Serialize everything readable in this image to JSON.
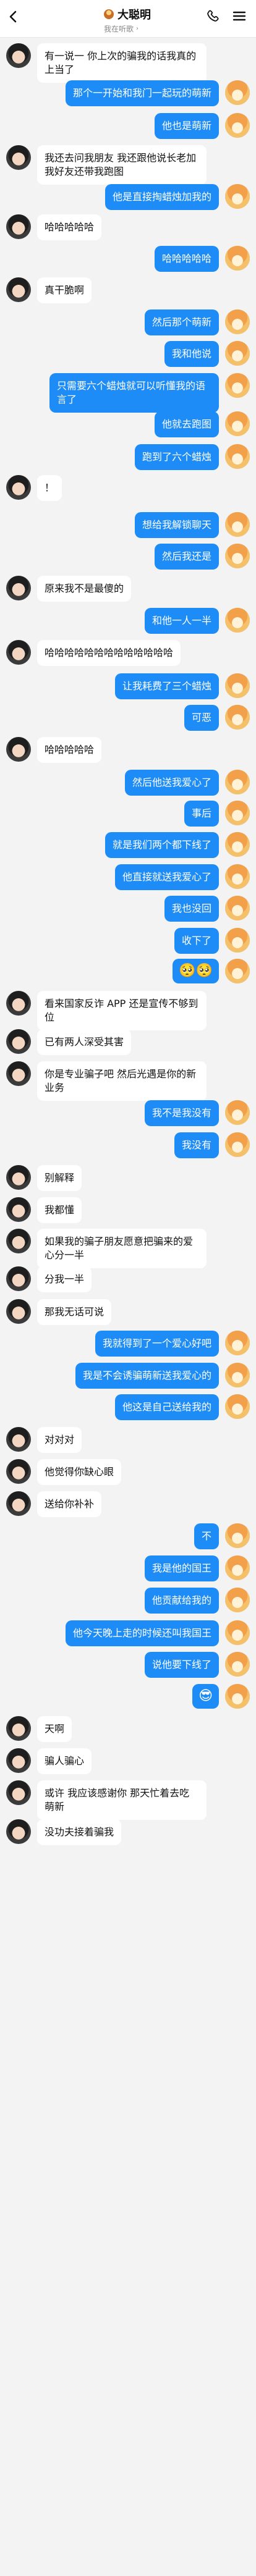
{
  "header": {
    "title": "大聪明",
    "subtitle": "我在听歌",
    "icons": {
      "back": "chevron-left",
      "phone": "phone",
      "menu": "hamburger-menu"
    }
  },
  "chat": {
    "messages": [
      {
        "type": "text",
        "side": "left",
        "text": "有一说一  你上次的骗我的话我真的  上当了"
      },
      {
        "type": "text",
        "side": "right",
        "text": "那个一开始和我门一起玩的萌新"
      },
      {
        "type": "text",
        "side": "right",
        "text": "他也是萌新"
      },
      {
        "type": "text",
        "side": "left",
        "text": "我还去问我朋友  我还跟他说长老加我好友还带我跑图"
      },
      {
        "type": "text",
        "side": "right",
        "text": "他是直接掏蜡烛加我的"
      },
      {
        "type": "text",
        "side": "left",
        "text": "哈哈哈哈哈"
      },
      {
        "type": "text",
        "side": "right",
        "text": "哈哈哈哈哈"
      },
      {
        "type": "text",
        "side": "left",
        "text": "真干脆啊"
      },
      {
        "type": "text",
        "side": "right",
        "text": "然后那个萌新"
      },
      {
        "type": "text",
        "side": "right",
        "text": "我和他说"
      },
      {
        "type": "text",
        "side": "right",
        "text": "只需要六个蜡烛就可以听懂我的语言了"
      },
      {
        "type": "text",
        "side": "right",
        "text": "他就去跑图"
      },
      {
        "type": "text",
        "side": "right",
        "text": "跑到了六个蜡烛"
      },
      {
        "type": "text",
        "side": "left",
        "text": "！"
      },
      {
        "type": "text",
        "side": "right",
        "text": "想给我解锁聊天"
      },
      {
        "type": "text",
        "side": "right",
        "text": "然后我还是"
      },
      {
        "type": "text",
        "side": "left",
        "text": "原来我不是最傻的"
      },
      {
        "type": "text",
        "side": "right",
        "text": "和他一人一半"
      },
      {
        "type": "text",
        "side": "left",
        "text": "哈哈哈哈哈哈哈哈哈哈哈哈哈"
      },
      {
        "type": "text",
        "side": "right",
        "text": "让我耗费了三个蜡烛"
      },
      {
        "type": "text",
        "side": "right",
        "text": "可恶"
      },
      {
        "type": "text",
        "side": "left",
        "text": "哈哈哈哈哈"
      },
      {
        "type": "text",
        "side": "right",
        "text": "然后他送我爱心了"
      },
      {
        "type": "text",
        "side": "right",
        "text": "事后"
      },
      {
        "type": "text",
        "side": "right",
        "text": "就是我们两个都下线了"
      },
      {
        "type": "text",
        "side": "right",
        "text": "他直接就送我爱心了"
      },
      {
        "type": "text",
        "side": "right",
        "text": "我也没回"
      },
      {
        "type": "text",
        "side": "right",
        "text": "收下了"
      },
      {
        "type": "emoji",
        "side": "right",
        "text": "🥺🥺"
      },
      {
        "type": "text",
        "side": "left",
        "text": "看来国家反诈 APP 还是宣传不够到位"
      },
      {
        "type": "text",
        "side": "left",
        "text": "已有两人深受其害"
      },
      {
        "type": "text",
        "side": "left",
        "text": "你是专业骗子吧  然后光遇是你的新业务"
      },
      {
        "type": "text",
        "side": "right",
        "text": "我不是我没有"
      },
      {
        "type": "text",
        "side": "right",
        "text": "我没有"
      },
      {
        "type": "text",
        "side": "left",
        "text": "别解释"
      },
      {
        "type": "text",
        "side": "left",
        "text": "我都懂"
      },
      {
        "type": "text",
        "side": "left",
        "text": "如果我的骗子朋友愿意把骗来的爱心分一半"
      },
      {
        "type": "text",
        "side": "left",
        "text": "分我一半"
      },
      {
        "type": "text",
        "side": "left",
        "text": "那我无话可说"
      },
      {
        "type": "text",
        "side": "right",
        "text": "我就得到了一个爱心好吧"
      },
      {
        "type": "text",
        "side": "right",
        "text": "我是不会诱骗萌新送我爱心的"
      },
      {
        "type": "text",
        "side": "right",
        "text": "他这是自己送给我的"
      },
      {
        "type": "text",
        "side": "left",
        "text": "对对对"
      },
      {
        "type": "text",
        "side": "left",
        "text": "他觉得你缺心眼"
      },
      {
        "type": "text",
        "side": "left",
        "text": "送给你补补"
      },
      {
        "type": "text",
        "side": "right",
        "text": "不"
      },
      {
        "type": "text",
        "side": "right",
        "text": "我是他的国王"
      },
      {
        "type": "text",
        "side": "right",
        "text": "他贡献给我的"
      },
      {
        "type": "text",
        "side": "right",
        "text": "他今天晚上走的时候还叫我国王"
      },
      {
        "type": "text",
        "side": "right",
        "text": "说他要下线了"
      },
      {
        "type": "emoji",
        "side": "right",
        "text": "😎"
      },
      {
        "type": "text",
        "side": "left",
        "text": "天啊"
      },
      {
        "type": "text",
        "side": "left",
        "text": "骗人骗心"
      },
      {
        "type": "text",
        "side": "left",
        "text": "或许  我应该感谢你  那天忙着去吃萌新"
      },
      {
        "type": "text",
        "side": "left",
        "text": "没功夫接着骗我"
      }
    ]
  }
}
